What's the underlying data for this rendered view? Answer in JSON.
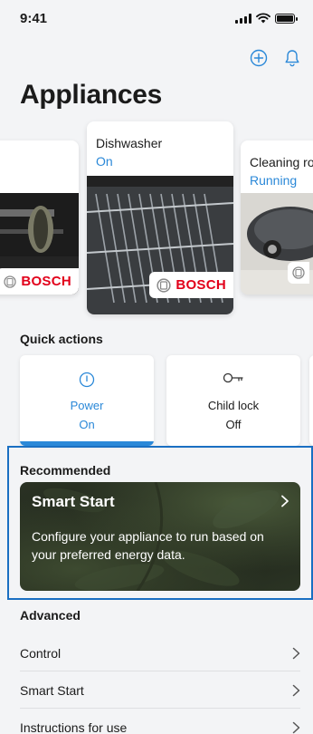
{
  "status": {
    "time": "9:41"
  },
  "header": {
    "title": "Appliances"
  },
  "appliances": [
    {
      "name": "",
      "state": "",
      "brand": "BOSCH"
    },
    {
      "name": "Dishwasher",
      "state": "On",
      "brand": "BOSCH"
    },
    {
      "name": "Cleaning ro",
      "state": "Running",
      "brand": ""
    }
  ],
  "quick_actions": {
    "heading": "Quick actions",
    "items": [
      {
        "label": "Power",
        "value": "On",
        "active": true,
        "icon": "power-icon"
      },
      {
        "label": "Child lock",
        "value": "Off",
        "active": false,
        "icon": "key-icon"
      }
    ]
  },
  "recommended": {
    "heading": "Recommended",
    "card": {
      "title": "Smart Start",
      "description": "Configure your appliance to run based on your preferred energy data."
    }
  },
  "advanced": {
    "heading": "Advanced",
    "items": [
      {
        "label": "Control"
      },
      {
        "label": "Smart Start"
      },
      {
        "label": "Instructions for use"
      }
    ]
  },
  "colors": {
    "accent": "#2a88d8",
    "brand_red": "#e2001a",
    "highlight_border": "#1a6fc2"
  }
}
